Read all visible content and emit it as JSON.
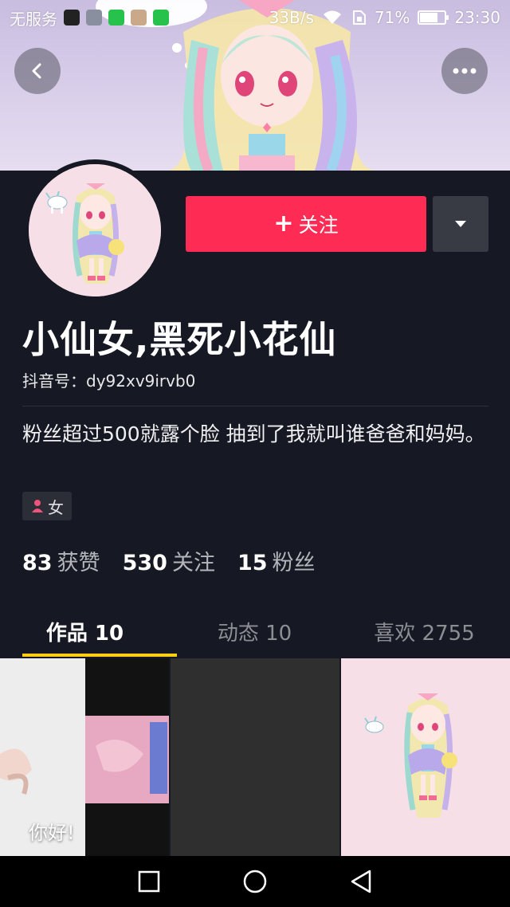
{
  "status_bar": {
    "carrier": "无服务",
    "net_speed": "33B/s",
    "battery_percent": "71%",
    "battery_level": 0.71,
    "time": "23:30"
  },
  "profile": {
    "name": "小仙女,黑死小花仙",
    "douyin_id": "抖音号：dy92xv9irvb0",
    "bio": "粉丝超过500就露个脸 抽到了我就叫谁爸爸和妈妈。",
    "gender": "女"
  },
  "actions": {
    "follow_label": "关注",
    "follow_plus": "+"
  },
  "stats": [
    {
      "num": "83",
      "label": "获赞"
    },
    {
      "num": "530",
      "label": "关注"
    },
    {
      "num": "15",
      "label": "粉丝"
    }
  ],
  "tabs": [
    {
      "label": "作品 10"
    },
    {
      "label": "动态 10"
    },
    {
      "label": "喜欢 2755"
    }
  ],
  "grid": {
    "first_caption": "你好!"
  },
  "colors": {
    "accent": "#fe2c55",
    "background": "#161823",
    "tab_indicator": "#face15"
  }
}
